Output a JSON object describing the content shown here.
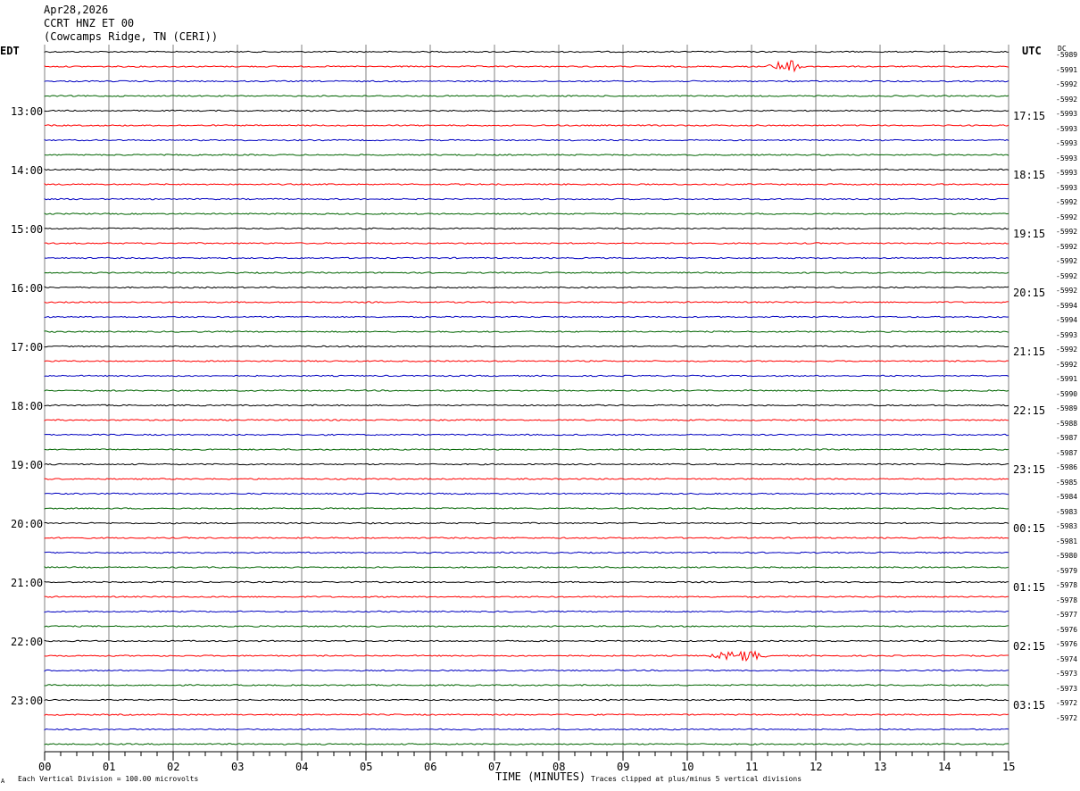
{
  "header": {
    "date": "Apr28,2026",
    "station": "CCRT HNZ ET 00",
    "location": "(Cowcamps Ridge, TN (CERI))"
  },
  "left_axis_title": "EDT",
  "right_axis_title": "UTC",
  "dc_title": "DC",
  "footer": {
    "scale_note": "Each Vertical Division =  100.00 microvolts",
    "xlabel": "TIME (MINUTES)",
    "clip_note": "Traces clipped at plus/minus 5 vertical divisions",
    "corner_mark": "A"
  },
  "colors": {
    "trace_cycle": [
      "#000000",
      "#ff0000",
      "#0000c0",
      "#006400"
    ],
    "grid": "#808080"
  },
  "chart_data": {
    "type": "line",
    "title": "CCRT HNZ ET 00",
    "xlabel": "TIME (MINUTES)",
    "xlim": [
      0,
      15
    ],
    "x_ticks": [
      "00",
      "01",
      "02",
      "03",
      "04",
      "05",
      "06",
      "07",
      "08",
      "09",
      "10",
      "11",
      "12",
      "13",
      "14",
      "15"
    ],
    "trace_count": 48,
    "edt_hour_labels": [
      "13:00",
      "14:00",
      "15:00",
      "16:00",
      "17:00",
      "18:00",
      "19:00",
      "20:00",
      "21:00",
      "22:00",
      "23:00"
    ],
    "utc_hour_labels": [
      "17:15",
      "18:15",
      "19:15",
      "20:15",
      "21:15",
      "22:15",
      "23:15",
      "00:15",
      "01:15",
      "02:15",
      "03:15"
    ],
    "dc_offsets": [
      "-5989",
      "-5991",
      "-5992",
      "-5992",
      "-5993",
      "-5993",
      "-5993",
      "-5993",
      "-5993",
      "-5993",
      "-5992",
      "-5992",
      "-5992",
      "-5992",
      "-5992",
      "-5992",
      "-5992",
      "-5994",
      "-5994",
      "-5993",
      "-5992",
      "-5992",
      "-5991",
      "-5990",
      "-5989",
      "-5988",
      "-5987",
      "-5987",
      "-5986",
      "-5985",
      "-5984",
      "-5983",
      "-5983",
      "-5981",
      "-5980",
      "-5979",
      "-5978",
      "-5978",
      "-5977",
      "-5976",
      "-5976",
      "-5974",
      "-5973",
      "-5973",
      "-5972",
      "-5972"
    ],
    "events": [
      {
        "trace": 1,
        "start_min": 11.2,
        "end_min": 11.9,
        "amplitude": 7
      },
      {
        "trace": 41,
        "start_min": 10.3,
        "end_min": 11.3,
        "amplitude": 6
      }
    ]
  }
}
